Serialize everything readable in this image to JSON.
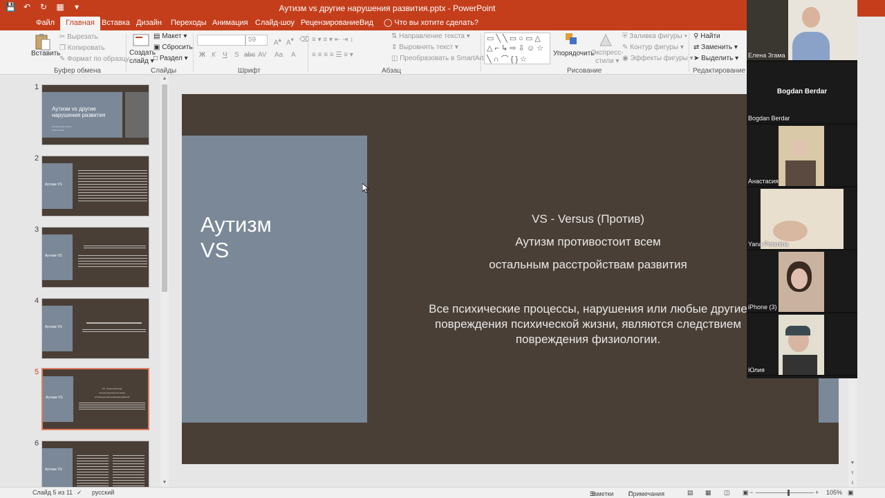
{
  "window": {
    "title": "Аутизм vs другие нарушения развития.pptx - PowerPoint",
    "accent": "#c43e1c"
  },
  "tabs": [
    "Файл",
    "Главная",
    "Вставка",
    "Дизайн",
    "Переходы",
    "Анимация",
    "Слайд-шоу",
    "Рецензирование",
    "Вид"
  ],
  "active_tab": "Главная",
  "tell_me": "Что вы хотите сделать?",
  "ribbon": {
    "clipboard": {
      "paste": "Вставить",
      "cut": "Вырезать",
      "copy": "Копировать",
      "format_painter": "Формат по образцу",
      "label": "Буфер обмена"
    },
    "slides": {
      "new_slide_line1": "Создать",
      "new_slide_line2": "слайд",
      "layout": "Макет",
      "reset": "Сбросить",
      "section": "Раздел",
      "label": "Слайды"
    },
    "font": {
      "size": "59",
      "bold": "Ж",
      "italic": "К",
      "underline": "Ч",
      "shadow": "S",
      "strike": "abc",
      "spacing": "AV",
      "case": "Aa",
      "color": "A",
      "label": "Шрифт"
    },
    "paragraph": {
      "text_direction": "Направление текста",
      "align_text": "Выровнять текст",
      "smartart": "Преобразовать в SmartArt",
      "label": "Абзац"
    },
    "drawing": {
      "arrange": "Упорядочить",
      "quick_styles_line1": "Экспресс-",
      "quick_styles_line2": "стили",
      "fill": "Заливка фигуры",
      "outline": "Контур фигуры",
      "effects": "Эффекты фигуры",
      "label": "Рисование"
    },
    "editing": {
      "find": "Найти",
      "replace": "Заменить",
      "select": "Выделить",
      "label": "Редактирование"
    }
  },
  "thumbnails": [
    {
      "num": "1",
      "title": "Аутизм vs другие нарушения развития",
      "sub1": "Презентацию делает",
      "sub2": "Елена Згама"
    },
    {
      "num": "2",
      "title": "Аутизм VS"
    },
    {
      "num": "3",
      "title": "Аутизм VS"
    },
    {
      "num": "4",
      "title": "Аутизм VS"
    },
    {
      "num": "5",
      "title": "Аутизм VS"
    },
    {
      "num": "6",
      "title": "Аутизм VS"
    }
  ],
  "slide": {
    "heading_line1": "Аутизм",
    "heading_line2": "VS",
    "line1": "VS - Versus (Против)",
    "line2": "Аутизм противостоит всем",
    "line3": "остальным расстройствам развития",
    "para_line1": "Все психические процессы, нарушения или любые другие",
    "para_line2": "повреждения психической жизни, являются следствием",
    "para_line3": "повреждения физиологии.",
    "thumb_line1": "VS - Versus (Против)",
    "thumb_line2": "Аутизм противостоит всем",
    "thumb_line3": "остальным расстройствам развития"
  },
  "participants": [
    {
      "name": "Елена Згама"
    },
    {
      "name": "Bogdan Berdar",
      "display": "Bogdan Berdar"
    },
    {
      "name": "Анастасия"
    },
    {
      "name": "Yana Potanina"
    },
    {
      "name": "iPhone (3)"
    },
    {
      "name": "Юлия"
    }
  ],
  "status": {
    "slide_of": "Слайд 5 из 11",
    "language": "русский",
    "notes": "Заметки",
    "comments": "Примечания",
    "zoom": "105%"
  }
}
